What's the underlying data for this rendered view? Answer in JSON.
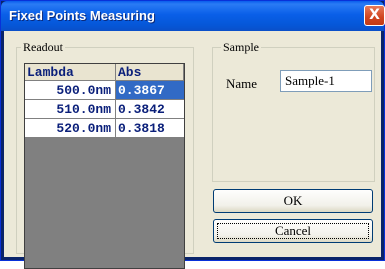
{
  "window": {
    "title": "Fixed Points Measuring",
    "close_glyph": "X"
  },
  "readout": {
    "label": "Readout",
    "columns": [
      "Lambda",
      "Abs"
    ],
    "rows": [
      {
        "lambda": "500.0nm",
        "abs": "0.3867"
      },
      {
        "lambda": "510.0nm",
        "abs": "0.3842"
      },
      {
        "lambda": "520.0nm",
        "abs": "0.3818"
      }
    ]
  },
  "sample": {
    "label": "Sample",
    "name_label": "Name",
    "name_value": "Sample-1"
  },
  "buttons": {
    "ok_label": "OK",
    "cancel_label": "Cancel"
  },
  "colors": {
    "title_bar": "#0a5fe8",
    "face": "#ece9d8",
    "selection": "#316ac5",
    "grid_text": "#0a1f7a"
  }
}
